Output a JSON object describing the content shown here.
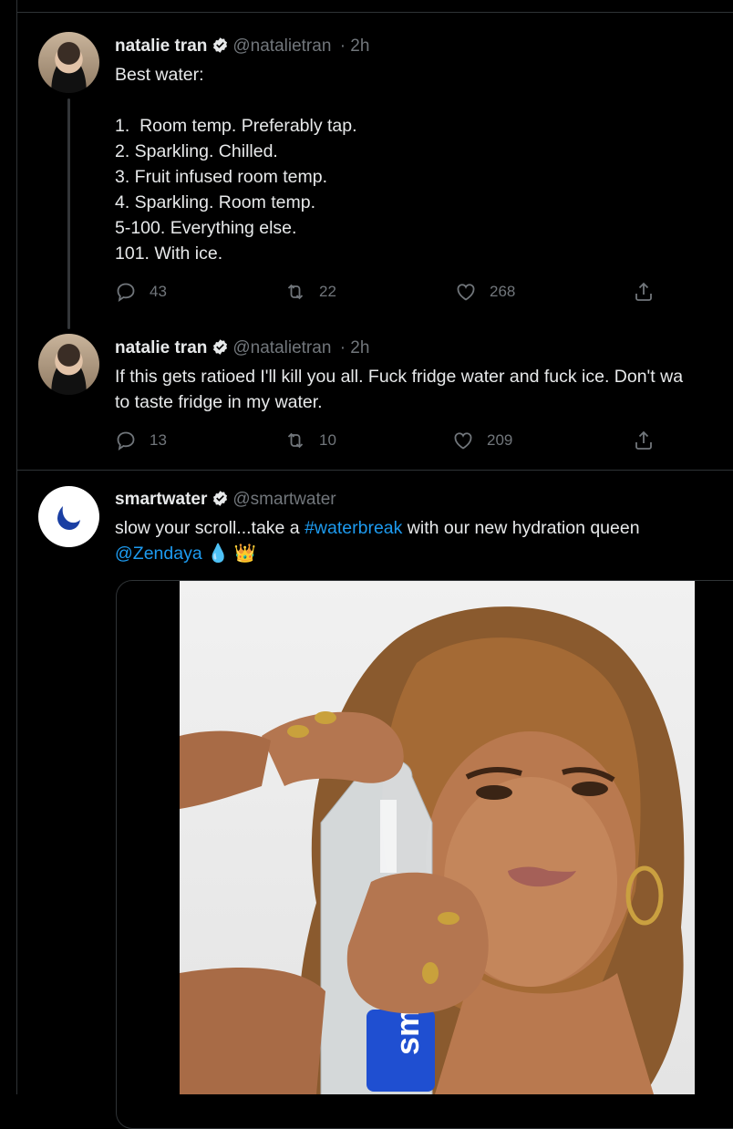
{
  "tweets": [
    {
      "name": "natalie tran",
      "handle": "@natalietran",
      "time": "· 2h",
      "text": "Best water:\n\n1.  Room temp. Preferably tap.\n2. Sparkling. Chilled.\n3. Fruit infused room temp.\n4. Sparkling. Room temp.\n5-100. Everything else.\n101. With ice.",
      "replies": "43",
      "retweets": "22",
      "likes": "268"
    },
    {
      "name": "natalie tran",
      "handle": "@natalietran",
      "time": "· 2h",
      "text": "If this gets ratioed I'll kill you all. Fuck fridge water and fuck ice. Don't wa\nto taste fridge in my water.",
      "replies": "13",
      "retweets": "10",
      "likes": "209"
    },
    {
      "name": "smartwater",
      "handle": "@smartwater",
      "text_before": "slow your scroll...take a ",
      "hashtag": "#waterbreak",
      "text_after": " with our new hydration queen",
      "mention": "@Zendaya",
      "emoji": "💧 👑"
    }
  ],
  "colors": {
    "accent": "#1d9bf0",
    "muted": "#71767b",
    "background": "#000000",
    "smartwater_blue": "#1a3fa3"
  },
  "icons": [
    "verified-badge-icon",
    "reply-icon",
    "retweet-icon",
    "like-icon",
    "share-icon",
    "water-drop-logo-icon"
  ]
}
